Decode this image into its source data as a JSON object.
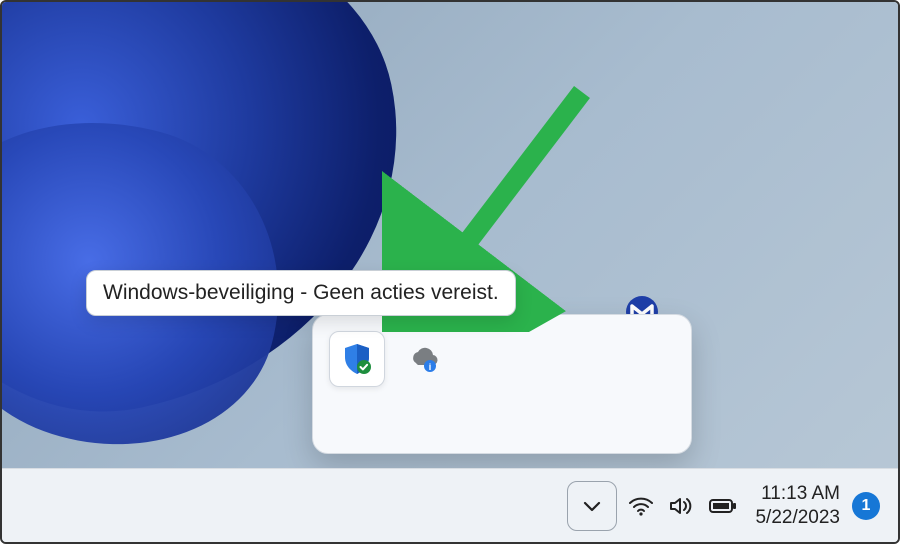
{
  "tooltip": {
    "text": "Windows-beveiliging - Geen acties vereist."
  },
  "tray": {
    "items": [
      {
        "name": "windows-security",
        "semantic": "shield-check-icon"
      },
      {
        "name": "onedrive",
        "semantic": "cloud-sync-icon"
      }
    ],
    "extra": {
      "name": "malwarebytes",
      "semantic": "malwarebytes-icon"
    }
  },
  "taskbar": {
    "toggle_semantic": "chevron-down-icon",
    "icons": [
      "wifi-icon",
      "volume-icon",
      "battery-icon"
    ],
    "clock": {
      "time": "11:13 AM",
      "date": "5/22/2023"
    },
    "notification_count": "1"
  },
  "annotations": {
    "arrow_color": "#2bb24c"
  }
}
